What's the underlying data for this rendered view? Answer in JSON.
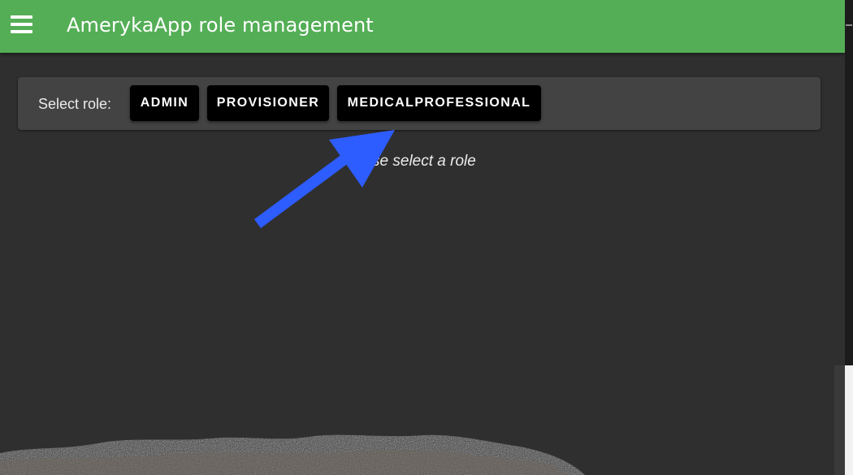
{
  "app_bar": {
    "title": "AmerykaApp role management",
    "menu_icon": "hamburger-menu-icon",
    "color": "#54ae56"
  },
  "role_selector": {
    "label": "Select role:",
    "roles": [
      "ADMIN",
      "PROVISIONER",
      "MEDICALPROFESSIONAL"
    ]
  },
  "hint": "Please select a role",
  "annotation": {
    "type": "arrow",
    "color": "#2d5cff",
    "points_to": "MEDICALPROFESSIONAL"
  }
}
